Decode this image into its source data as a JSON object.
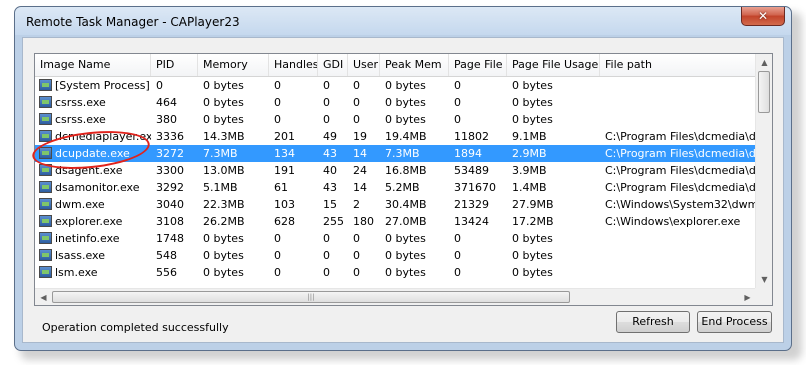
{
  "window": {
    "title": "Remote Task Manager - CAPlayer23",
    "close_icon": "close-icon",
    "close_glyph": "✕"
  },
  "table": {
    "columns": [
      "Image Name",
      "PID",
      "Memory",
      "Handles",
      "GDI",
      "User",
      "Peak Mem",
      "Page File",
      "Page File Usage",
      "File path"
    ],
    "rows": [
      [
        "[System Process]",
        "0",
        "0 bytes",
        "0",
        "0",
        "0",
        "0 bytes",
        "0",
        "0 bytes",
        ""
      ],
      [
        "csrss.exe",
        "464",
        "0 bytes",
        "0",
        "0",
        "0",
        "0 bytes",
        "0",
        "0 bytes",
        ""
      ],
      [
        "csrss.exe",
        "380",
        "0 bytes",
        "0",
        "0",
        "0",
        "0 bytes",
        "0",
        "0 bytes",
        ""
      ],
      [
        "dcmediaplayer.exe",
        "3336",
        "14.3MB",
        "201",
        "49",
        "19",
        "19.4MB",
        "11802",
        "9.1MB",
        "C:\\Program Files\\dcmedia\\dc"
      ],
      [
        "dcupdate.exe",
        "3272",
        "7.3MB",
        "134",
        "43",
        "14",
        "7.3MB",
        "1894",
        "2.9MB",
        "C:\\Program Files\\dcmedia\\dc"
      ],
      [
        "dsagent.exe",
        "3300",
        "13.0MB",
        "191",
        "40",
        "24",
        "16.8MB",
        "53489",
        "3.9MB",
        "C:\\Program Files\\dcmedia\\ds"
      ],
      [
        "dsamonitor.exe",
        "3292",
        "5.1MB",
        "61",
        "43",
        "14",
        "5.2MB",
        "371670",
        "1.4MB",
        "C:\\Program Files\\dcmedia\\ds"
      ],
      [
        "dwm.exe",
        "3040",
        "22.3MB",
        "103",
        "15",
        "2",
        "30.4MB",
        "21329",
        "27.9MB",
        "C:\\Windows\\System32\\dwm."
      ],
      [
        "explorer.exe",
        "3108",
        "26.2MB",
        "628",
        "255",
        "180",
        "27.0MB",
        "13424",
        "17.2MB",
        "C:\\Windows\\explorer.exe"
      ],
      [
        "inetinfo.exe",
        "1748",
        "0 bytes",
        "0",
        "0",
        "0",
        "0 bytes",
        "0",
        "0 bytes",
        ""
      ],
      [
        "lsass.exe",
        "548",
        "0 bytes",
        "0",
        "0",
        "0",
        "0 bytes",
        "0",
        "0 bytes",
        ""
      ],
      [
        "lsm.exe",
        "556",
        "0 bytes",
        "0",
        "0",
        "0",
        "0 bytes",
        "0",
        "0 bytes",
        ""
      ]
    ],
    "selected_row": "dcupdate.exe",
    "row_icon": "process-icon"
  },
  "status": {
    "text": "Operation completed successfully"
  },
  "buttons": {
    "refresh_label": "Refresh",
    "end_process_label": "End Process"
  },
  "colors": {
    "selection": "#3399ff",
    "annotation": "#e0231c"
  }
}
